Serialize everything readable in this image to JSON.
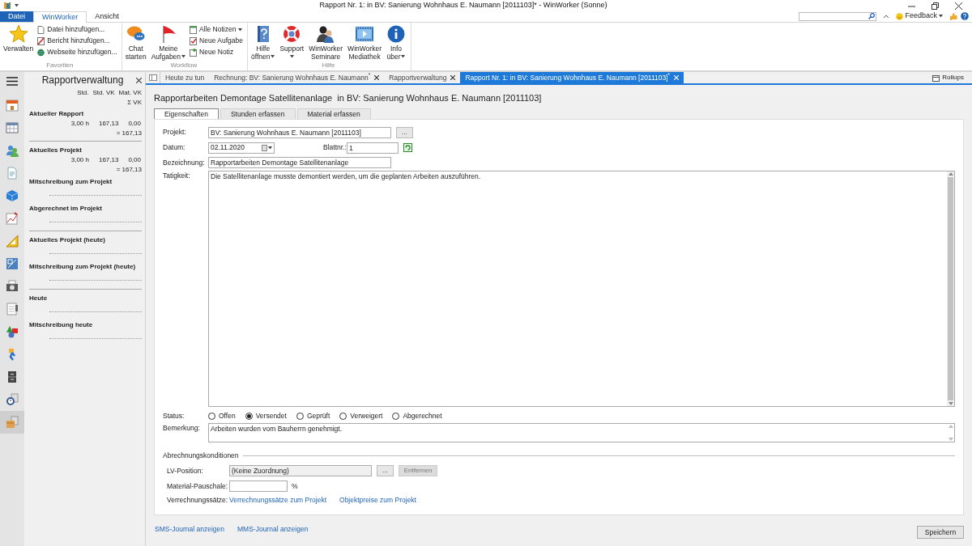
{
  "window": {
    "title": "Rapport Nr. 1: in BV: Sanierung Wohnhaus E. Naumann [2011103]* - WinWorker (Sonne)"
  },
  "ribbon_tabs": [
    {
      "label": "Datei",
      "kind": "file",
      "selected": false
    },
    {
      "label": "WinWorker",
      "kind": "tab",
      "selected": true
    },
    {
      "label": "Ansicht",
      "kind": "tab",
      "selected": false
    }
  ],
  "feedback": {
    "label": "Feedback"
  },
  "ribbon_groups": [
    {
      "name": "Favoriten",
      "items": [
        {
          "kind": "large",
          "lines": [
            "Verwalten"
          ],
          "dropdown": false
        },
        {
          "kind": "stack",
          "entries": [
            {
              "label": "Datei hinzufügen...",
              "dropdown": false
            },
            {
              "label": "Bericht hinzufügen...",
              "dropdown": false
            },
            {
              "label": "Webseite hinzufügen...",
              "dropdown": false
            }
          ]
        }
      ]
    },
    {
      "name": "Workflow",
      "items": [
        {
          "kind": "large",
          "lines": [
            "Chat",
            "starten"
          ],
          "dropdown": false
        },
        {
          "kind": "large",
          "lines": [
            "Meine",
            "Aufgaben"
          ],
          "dropdown": true
        },
        {
          "kind": "stack",
          "entries": [
            {
              "label": "Alle Notizen",
              "dropdown": true
            },
            {
              "label": "Neue Aufgabe",
              "dropdown": false
            },
            {
              "label": "Neue Notiz",
              "dropdown": false
            }
          ]
        }
      ]
    },
    {
      "name": "Hilfe",
      "items": [
        {
          "kind": "large",
          "lines": [
            "Hilfe",
            "öffnen"
          ],
          "dropdown": true
        },
        {
          "kind": "large",
          "lines": [
            "Support"
          ],
          "dropdown": true
        },
        {
          "kind": "large",
          "lines": [
            "WinWorker",
            "Seminare"
          ],
          "dropdown": false
        },
        {
          "kind": "large",
          "lines": [
            "WinWorker",
            "Mediathek"
          ],
          "dropdown": false
        },
        {
          "kind": "large",
          "lines": [
            "Info",
            "über"
          ],
          "dropdown": true
        }
      ]
    }
  ],
  "rail": [
    {
      "selected": false
    },
    {
      "selected": false
    },
    {
      "selected": false
    },
    {
      "selected": false
    },
    {
      "selected": false
    },
    {
      "selected": false
    },
    {
      "selected": false
    },
    {
      "selected": false
    },
    {
      "selected": false
    },
    {
      "selected": false
    },
    {
      "selected": false
    },
    {
      "selected": false
    },
    {
      "selected": false
    },
    {
      "selected": false
    },
    {
      "selected": true
    }
  ],
  "panel": {
    "title": "Rapportverwaltung",
    "columns": [
      "Std.",
      "Std. VK",
      "Mat. VK"
    ],
    "sum_label": "Σ VK",
    "groups": [
      {
        "sections": [
          {
            "title": "Aktueller Rapport",
            "kind": "values",
            "values": [
              "3,00 h",
              "167,13",
              "0,00"
            ],
            "total": "= 167,13"
          }
        ]
      },
      {
        "sections": [
          {
            "title": "Aktuelles Projekt",
            "kind": "values",
            "values": [
              "3,00 h",
              "167,13",
              "0,00"
            ],
            "total": "= 167,13"
          },
          {
            "title": "Mitschreibung zum Projekt",
            "kind": "empty"
          },
          {
            "title": "Abgerechnet im Projekt",
            "kind": "empty"
          }
        ]
      },
      {
        "sections": [
          {
            "title": "Aktuelles Projekt (heute)",
            "kind": "empty"
          },
          {
            "title": "Mitschreibung zum Projekt (heute)",
            "kind": "empty"
          }
        ]
      },
      {
        "sections": [
          {
            "title": "Heute",
            "kind": "empty"
          },
          {
            "title": "Mitschreibung heute",
            "kind": "empty"
          }
        ]
      }
    ]
  },
  "doc_tabs": [
    {
      "label": "Heute zu tun",
      "closable": false,
      "selected": false
    },
    {
      "label": "Rechnung: BV: Sanierung Wohnhaus E. Naumann$^{*}$",
      "closable": true,
      "selected": false
    },
    {
      "label": "Rapportverwaltung",
      "closable": true,
      "selected": false
    },
    {
      "label": "Rapport Nr. 1: in BV: Sanierung Wohnhaus E. Naumann [2011103]$^{*}$",
      "closable": true,
      "selected": true
    }
  ],
  "rollups": {
    "label": "Rollups"
  },
  "heading": "Rapportarbeiten Demontage Satellitenanlage  in BV: Sanierung Wohnhaus E. Naumann [2011103]",
  "form_tabs": [
    {
      "label": "Eigenschaften",
      "selected": true
    },
    {
      "label": "Stunden erfassen",
      "selected": false
    },
    {
      "label": "Material erfassen",
      "selected": false
    }
  ],
  "form": {
    "projekt": {
      "label": "Projekt:",
      "value": "BV: Sanierung Wohnhaus E. Naumann [2011103]",
      "button": "..."
    },
    "datum": {
      "label": "Datum:",
      "value": "02.11.2020"
    },
    "blatt": {
      "label": "Blattnr.:",
      "value": "1"
    },
    "bezeichnung": {
      "label": "Bezeichnung:",
      "value": "Rapportarbeiten Demontage Satellitenanlage"
    },
    "taetigkeit": {
      "label": "Tatigkeit:",
      "value": "Die Satellitenanlage musste demontiert werden, um die geplanten Arbeiten auszuführen."
    },
    "status": {
      "label": "Status:",
      "options": [
        {
          "label": "Offen",
          "selected": false
        },
        {
          "label": "Versendet",
          "selected": true
        },
        {
          "label": "Geprüft",
          "selected": false
        },
        {
          "label": "Verweigert",
          "selected": false
        },
        {
          "label": "Abgerechnet",
          "selected": false
        }
      ]
    },
    "bemerkung": {
      "label": "Bemerkung:",
      "value": "Arbeiten wurden vom Bauherrn genehmigt."
    }
  },
  "billing": {
    "title": "Abrechnungskonditionen",
    "lv": {
      "label": "LV-Position:",
      "value": "(Keine Zuordnung)",
      "button": "...",
      "remove": "Entfernen",
      "remove_disabled": true
    },
    "pauschale": {
      "label": "Material-Pauschale:",
      "unit": "%"
    },
    "saetze": {
      "label": "Verrechnungssätze:",
      "links": [
        "Verrechnungssätze zum Projekt",
        "Objektpreise zum Projekt"
      ]
    }
  },
  "footer_links": [
    "SMS-Journal anzeigen",
    "MMS-Journal anzeigen"
  ],
  "save_button": "Speichern"
}
